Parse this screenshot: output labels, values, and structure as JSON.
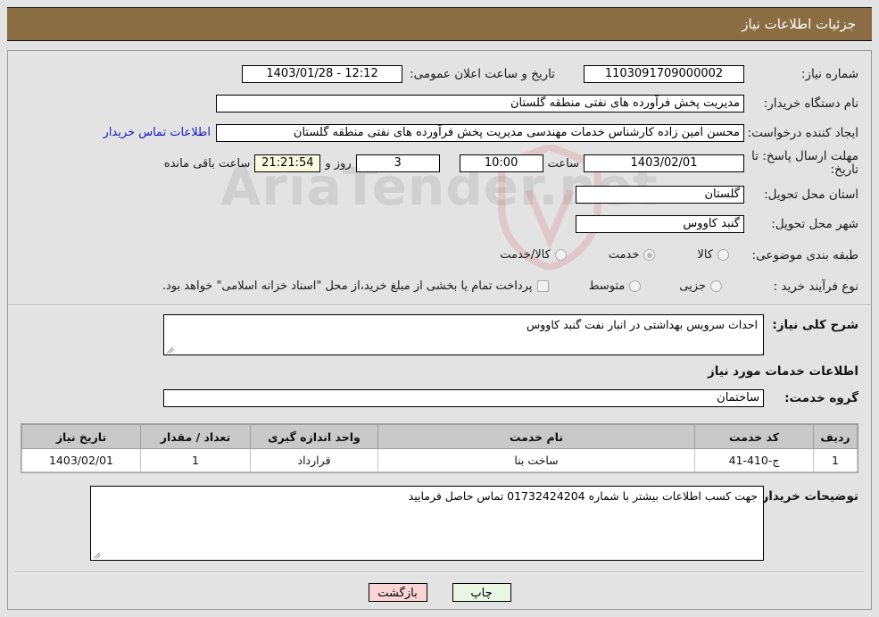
{
  "window": {
    "title": "جزئیات اطلاعات نیاز",
    "title_bg": "#8b6d43",
    "watermark": "AriaTender.net"
  },
  "form": {
    "need_number_label": "شماره نیاز:",
    "need_number_value": "1103091709000002",
    "announce_label": "تاریخ و ساعت اعلان عمومی:",
    "announce_value": "1403/01/28 - 12:12",
    "buyer_org_label": "نام دستگاه خریدار:",
    "buyer_org_value": "مدیریت پخش فرآورده های نفتی منطقه گلستان",
    "creator_label": "ایجاد کننده درخواست:",
    "creator_value": "محسن امین زاده کارشناس خدمات مهندسی مدیریت پخش فرآورده های نفتی منطقه گلستان",
    "contact_link": "اطلاعات تماس خریدار",
    "deadline_label": "مهلت ارسال پاسخ: تا تاریخ:",
    "deadline_date": "1403/02/01",
    "deadline_hour_label": "ساعت",
    "deadline_hour_value": "10:00",
    "remaining_days": "3",
    "remaining_days_label": "روز و",
    "remaining_time": "21:21:54",
    "remaining_suffix": "ساعت باقی مانده",
    "province_label": "استان محل تحویل:",
    "province_value": "گلستان",
    "city_label": "شهر محل تحویل:",
    "city_value": "گنبد کاووس",
    "category_label": "طبقه بندی موضوعی:",
    "category_options": [
      {
        "label": "کالا",
        "selected": false
      },
      {
        "label": "خدمت",
        "selected": true
      },
      {
        "label": "کالا/خدمت",
        "selected": false
      }
    ],
    "process_label": "نوع فرآیند خرید :",
    "process_options": [
      {
        "label": "جزیی",
        "selected": false
      },
      {
        "label": "متوسط",
        "selected": false
      }
    ],
    "payment_checkbox_label": "پرداخت تمام یا بخشی از مبلغ خرید،از محل \"اسناد خزانه اسلامی\" خواهد بود.",
    "payment_checked": false
  },
  "need_summary": {
    "label": "شرح کلی نیاز:",
    "value": "احداث سرویس بهداشتی در انبار نفت گنبد کاووس"
  },
  "services_section": {
    "heading": "اطلاعات خدمات مورد نیاز",
    "group_label": "گروه خدمت:",
    "group_value": "ساختمان"
  },
  "table": {
    "headers": [
      "ردیف",
      "کد خدمت",
      "نام خدمت",
      "واحد اندازه گیری",
      "تعداد / مقدار",
      "تاریخ نیاز"
    ],
    "rows": [
      {
        "index": "1",
        "code": "ج-410-41",
        "name": "ساخت بنا",
        "unit": "قرارداد",
        "quantity": "1",
        "date": "1403/02/01"
      }
    ]
  },
  "buyer_notes": {
    "label": "توضیحات خریدار:",
    "value": "جهت کسب  اطلاعات بیشتر با شماره 01732424204 تماس حاصل فرمایید"
  },
  "footer": {
    "print_label": "چاپ",
    "back_label": "بازگشت"
  }
}
